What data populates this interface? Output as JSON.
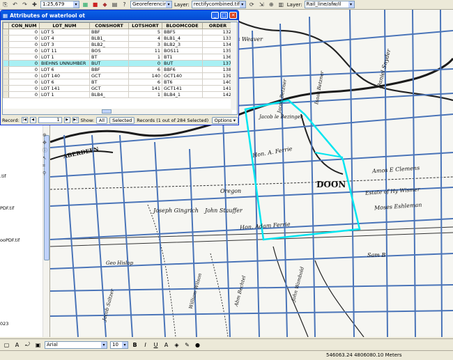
{
  "toolbar": {
    "scale": "1:25,679",
    "georef_label": "Georeferencing",
    "layer_label": "Layer:",
    "layer_value": "rectifycombined.tif",
    "layer2_label": "Layer:",
    "layer2_value": "Rail_line/afw/il"
  },
  "toc": {
    "items": [
      ".tif",
      "PDF.tif",
      "ooPDF.tif",
      "023"
    ]
  },
  "attr_table": {
    "title": "Attributes of waterlool ot",
    "columns": [
      "CON_NUM",
      "LOT_NUM",
      "CONSHORT",
      "LOTSHORT",
      "BLOOMCODE",
      "ORDER"
    ],
    "rows": [
      [
        "0",
        "LOT 5",
        "BBF",
        "5",
        "BBF5",
        "132"
      ],
      [
        "0",
        "LOT 4",
        "BLB1_",
        "4",
        "BLB1_4",
        "133"
      ],
      [
        "0",
        "LOT 3",
        "BLB2_",
        "3",
        "BLB2_3",
        "134"
      ],
      [
        "0",
        "LOT 11",
        "BOS",
        "11",
        "BOS11",
        "135"
      ],
      [
        "0",
        "LOT 1",
        "BT",
        "1",
        "BT1",
        "136"
      ],
      [
        "0",
        "BIEHNS UNNUMBER",
        "BUT",
        "0",
        "BUT",
        "137"
      ],
      [
        "0",
        "LOT 6",
        "BBF",
        "6",
        "BBF6",
        "138"
      ],
      [
        "0",
        "LOT 140",
        "GCT",
        "140",
        "GCT140",
        "139"
      ],
      [
        "0",
        "LOT 6",
        "BT",
        "6",
        "BT6",
        "140"
      ],
      [
        "0",
        "LOT 141",
        "GCT",
        "141",
        "GCT141",
        "141"
      ],
      [
        "0",
        "LOT 1",
        "BLB4_",
        "1",
        "BLB4_1",
        "142"
      ]
    ],
    "highlight_row": 5,
    "record_label": "Record:",
    "record_value": "1",
    "show_label": "Show:",
    "show_all": "All",
    "show_selected": "Selected",
    "records_info": "Records (1 out of 284 Selected)",
    "options_label": "Options"
  },
  "map_labels": [
    "Amos Weaver",
    "Daniel Snyder",
    "Jacob Betzner",
    "Isaac Betzner",
    "Jacob le Bezinger",
    "Hon. A. Ferrie",
    "DOON",
    "Estate of Hy Wismer",
    "Amos E Clemens",
    "Moses Eshleman",
    "Hon. Adam Ferrie",
    "Joseph Gingrich",
    "John Stauffer",
    "Oregon",
    "Geo Hislop",
    "John Wambold",
    "Abm Bechtel",
    "Sam B",
    "William Wilson",
    "Jacob Saltzer",
    "ABERDEEN"
  ],
  "bottom_toolbar": {
    "font_name": "Arial",
    "font_size": "10"
  },
  "status": {
    "coords": "546063.24  4806080.10 Meters"
  },
  "colors": {
    "parcel_lines": "#4A74B8",
    "selection": "#00E5F0",
    "title_bar": "#0A5FE8",
    "highlight_row": "#A8F0F4"
  }
}
